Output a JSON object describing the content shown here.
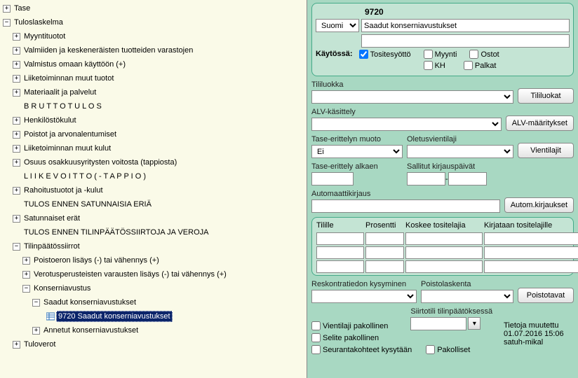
{
  "tree": {
    "tase": "Tase",
    "tuloslaskelma": "Tuloslaskelma",
    "items": [
      "Myyntituotot",
      "Valmiiden ja keskeneräisten tuotteiden varastojen",
      "Valmistus omaan käyttöön (+)",
      "Liiketoiminnan muut tuotot",
      "Materiaalit ja palvelut",
      "B R U T T O T U L O S",
      "Henkilöstökulut",
      "Poistot ja arvonalentumiset",
      "Liiketoiminnan muut kulut",
      "Osuus osakkuusyritysten voitosta (tappiosta)",
      "L I I K E V O I T T O   ( - T A P P I O )",
      "Rahoitustuotot ja -kulut",
      "TULOS ENNEN SATUNNAISIA ERIÄ",
      "Satunnaiset erät",
      "TULOS ENNEN TILINPÄÄTÖSSIIRTOJA  JA VEROJA"
    ],
    "tps": "Tilinpäätössiirrot",
    "tps_children": [
      "Poistoeron lisäys (-) tai vähennys (+)",
      "Verotusperusteisten varausten lisäys (-) tai vähennys (+)"
    ],
    "konserniavustus": "Konserniavustus",
    "saadut": "Saadut konserniavustukset",
    "leaf": "9720 Saadut konserniavustukset",
    "annetut": "Annetut konserniavustukset",
    "tuloverot": "Tuloverot"
  },
  "header": {
    "code": "9720",
    "lang": "Suomi",
    "name": "Saadut konserniavustukset",
    "kaytossa_label": "Käytössä:",
    "chk_tositesyotto": "Tositesyöttö",
    "chk_myynti": "Myynti",
    "chk_ostot": "Ostot",
    "chk_kh": "KH",
    "chk_palkat": "Palkat"
  },
  "fields": {
    "tililuokka": "Tililuokka",
    "btn_tililuokat": "Tililuokat",
    "alv": "ALV-käsittely",
    "btn_alv": "ALV-määritykset",
    "tase_muoto": "Tase-erittelyn muoto",
    "tase_muoto_val": "Ei",
    "oletusvientilaji": "Oletusvientilaji",
    "btn_vientilajit": "Vientilajit",
    "tase_alkaen": "Tase-erittely alkaen",
    "sallitut": "Sallitut kirjauspäivät",
    "automaattikirjaus": "Automaattikirjaus",
    "btn_autom": "Autom.kirjaukset",
    "col_tilille": "Tilille",
    "col_prosentti": "Prosentti",
    "col_koskee": "Koskee tositelajia",
    "col_kirjataan": "Kirjataan tositelajille",
    "reskontra": "Reskontratiedon kysyminen",
    "poistolaskenta": "Poistolaskenta",
    "btn_poistotavat": "Poistotavat",
    "vientilaji_pakollinen": "Vientilaji pakollinen",
    "siirtotili": "Siirtotili tilinpäätöksessä",
    "selite_pakollinen": "Selite pakollinen",
    "seurantakohteet": "Seurantakohteet kysytään",
    "pakolliset": "Pakolliset",
    "tietoja_muutettu": "Tietoja muutettu",
    "ts": "01.07.2016 15:06",
    "user": "satuh-mikal"
  }
}
